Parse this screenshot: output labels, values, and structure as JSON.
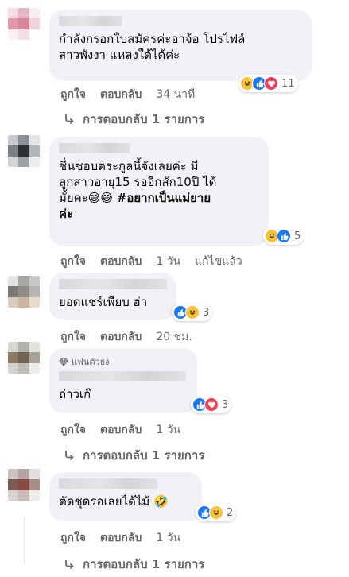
{
  "actions": {
    "like": "ถูกใจ",
    "reply": "ตอบกลับ"
  },
  "comments": [
    {
      "text": "กำลังกรอกใบสมัครค่ะอาจ้อ โปรไฟล์\nสาวพังงา แหลงใต้ได้ค่ะ",
      "reactions": [
        "haha",
        "like",
        "love"
      ],
      "reaction_count": "11",
      "time": "34 นาที",
      "edited": "",
      "replies": "การตอบกลับ 1 รายการ"
    },
    {
      "text_plain": "ชื่นชอบตระกูลนี้จังเลยค่ะ มี\nลูกสาวอายุ15 รออีกสัก10ปี ได้\nมั้ยคะ😅😅 ",
      "text_bold": "#อยากเป็นแม่ยาย\nค่ะ",
      "reactions": [
        "haha",
        "like"
      ],
      "reaction_count": "5",
      "time": "1 วัน",
      "edited": "แก้ไขแล้ว"
    },
    {
      "text": "ยอดแชร์เพียบ ฮ่า",
      "reactions": [
        "like",
        "haha"
      ],
      "reaction_count": "3",
      "time": "20 ชม."
    },
    {
      "badge": "แฟนตัวยง",
      "text": "ถ่าวเก๊",
      "reactions": [
        "like",
        "love"
      ],
      "reaction_count": "3",
      "time": "1 วัน",
      "replies": "การตอบกลับ 1 รายการ"
    },
    {
      "text": "ตัดชุดรอเลยได้ไม้ 🤣",
      "reactions": [
        "like",
        "haha"
      ],
      "reaction_count": "2",
      "time": "1 วัน",
      "replies": "การตอบกลับ 1 รายการ"
    }
  ],
  "colors": {
    "bubble": "#f0f2f5",
    "meta": "#65676b",
    "like": "#1877f2",
    "haha": "#f7c43c",
    "love": "#f33e58"
  }
}
